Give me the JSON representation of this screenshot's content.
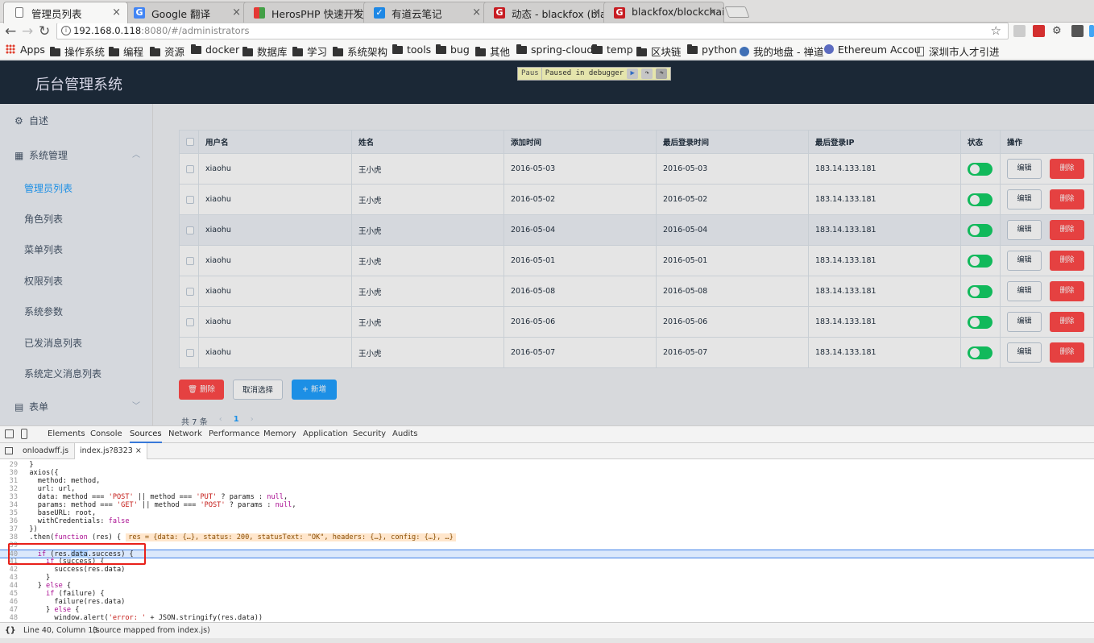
{
  "browser": {
    "tabs": [
      {
        "label": "管理员列表",
        "icon": "page-icon",
        "active": true
      },
      {
        "label": "Google 翻译",
        "icon": "google-icon"
      },
      {
        "label": "HerosPHP 快速开发",
        "icon": "herosphp-icon"
      },
      {
        "label": "有道云笔记",
        "icon": "youdao-icon"
      },
      {
        "label": "动态 - blackfox (bla",
        "icon": "gitee-icon"
      },
      {
        "label": "blackfox/blockchai",
        "icon": "gitee-icon"
      }
    ],
    "url_host": "192.168.0.118",
    "url_path": ":8080/#/administrators",
    "bookmarks": [
      "Apps",
      "操作系统",
      "编程",
      "资源",
      "docker",
      "数据库",
      "学习",
      "系统架构",
      "tools",
      "bug",
      "其他",
      "spring-cloud",
      "temp",
      "区块链",
      "python",
      "我的地盘 - 禅道",
      "Ethereum Accou",
      "深圳市人才引进"
    ]
  },
  "app": {
    "title": "后台管理系统",
    "debugger_left": "Paus",
    "debugger_text": "Paused in debugger",
    "sidebar": {
      "overview": "自述",
      "system": "系统管理",
      "sub_items": [
        "管理员列表",
        "角色列表",
        "菜单列表",
        "权限列表",
        "系统参数",
        "已发消息列表",
        "系统定义消息列表"
      ],
      "forms": "表单"
    },
    "table": {
      "headers": [
        "用户名",
        "姓名",
        "添加时间",
        "最后登录时间",
        "最后登录IP",
        "状态",
        "操作"
      ],
      "rows": [
        {
          "username": "xiaohu",
          "name": "王小虎",
          "added": "2016-05-03",
          "last_login": "2016-05-03",
          "ip": "183.14.133.181"
        },
        {
          "username": "xiaohu",
          "name": "王小虎",
          "added": "2016-05-02",
          "last_login": "2016-05-02",
          "ip": "183.14.133.181"
        },
        {
          "username": "xiaohu",
          "name": "王小虎",
          "added": "2016-05-04",
          "last_login": "2016-05-04",
          "ip": "183.14.133.181"
        },
        {
          "username": "xiaohu",
          "name": "王小虎",
          "added": "2016-05-01",
          "last_login": "2016-05-01",
          "ip": "183.14.133.181"
        },
        {
          "username": "xiaohu",
          "name": "王小虎",
          "added": "2016-05-08",
          "last_login": "2016-05-08",
          "ip": "183.14.133.181"
        },
        {
          "username": "xiaohu",
          "name": "王小虎",
          "added": "2016-05-06",
          "last_login": "2016-05-06",
          "ip": "183.14.133.181"
        },
        {
          "username": "xiaohu",
          "name": "王小虎",
          "added": "2016-05-07",
          "last_login": "2016-05-07",
          "ip": "183.14.133.181"
        }
      ],
      "edit_label": "编辑",
      "delete_label": "删除"
    },
    "actions": {
      "delete": "删除",
      "cancel_select": "取消选择",
      "add": "新增"
    },
    "pager": {
      "total": "共 7 条",
      "prev": "‹",
      "page": "1",
      "next": "›"
    }
  },
  "devtools": {
    "tabs": [
      "Elements",
      "Console",
      "Sources",
      "Network",
      "Performance",
      "Memory",
      "Application",
      "Security",
      "Audits"
    ],
    "active_tab": "Sources",
    "files": [
      "onloadwff.js",
      "index.js?8323"
    ],
    "code_lines": [
      {
        "n": "29",
        "t": "  }"
      },
      {
        "n": "30",
        "t": "  axios({"
      },
      {
        "n": "31",
        "t": "    method: method,"
      },
      {
        "n": "32",
        "t": "    url: url,"
      },
      {
        "n": "33",
        "t": "    data: method === 'POST' || method === 'PUT' ? params : null,"
      },
      {
        "n": "34",
        "t": "    params: method === 'GET' || method === 'POST' ? params : null,"
      },
      {
        "n": "35",
        "t": "    baseURL: root,"
      },
      {
        "n": "36",
        "t": "    withCredentials: false"
      },
      {
        "n": "37",
        "t": "  })"
      },
      {
        "n": "38",
        "t": "  .then(function (res) {",
        "inline": "res = {data: {…}, status: 200, statusText: \"OK\", headers: {…}, config: {…}, …}"
      },
      {
        "n": "39",
        "t": ""
      },
      {
        "n": "40",
        "t": "    if (res.data.success) {",
        "current": true
      },
      {
        "n": "41",
        "t": "      if (success) {"
      },
      {
        "n": "42",
        "t": "        success(res.data)"
      },
      {
        "n": "43",
        "t": "      }"
      },
      {
        "n": "44",
        "t": "    } else {"
      },
      {
        "n": "45",
        "t": "      if (failure) {"
      },
      {
        "n": "46",
        "t": "        failure(res.data)"
      },
      {
        "n": "47",
        "t": "      } else {"
      },
      {
        "n": "48",
        "t": "        window.alert('error: ' + JSON.stringify(res.data))"
      }
    ],
    "status": "Line 40, Column 13",
    "status_source": "(source mapped from index.js)",
    "status_icon": "{}"
  }
}
